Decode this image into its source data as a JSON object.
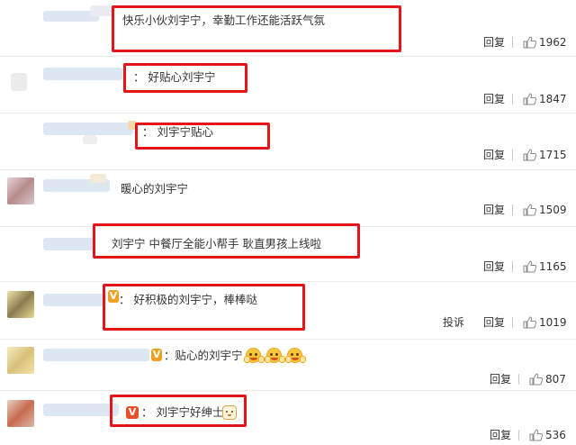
{
  "comments": [
    {
      "text": "快乐小伙刘宇宁，幸勤工作还能活跃气氛",
      "reply": "回复",
      "likes": "1962"
    },
    {
      "text": "：  好贴心刘宇宁",
      "reply": "回复",
      "likes": "1847"
    },
    {
      "text": "：  刘宇宁贴心",
      "reply": "回复",
      "likes": "1715"
    },
    {
      "text": "暖心的刘宇宁",
      "reply": "回复",
      "likes": "1509"
    },
    {
      "text": "刘宇宁 中餐厅全能小帮手 耿直男孩上线啦",
      "reply": "回复",
      "likes": "1165"
    },
    {
      "text": "：  好积极的刘宇宁，棒棒哒",
      "report": "投诉",
      "reply": "回复",
      "likes": "1019"
    },
    {
      "text": "：贴心的刘宇宁",
      "reply": "回复",
      "likes": "807"
    },
    {
      "text": "：  刘宇宁好绅士",
      "reply": "回复",
      "likes": "536"
    }
  ],
  "badges": {
    "vip_mark": "V"
  },
  "colors": {
    "highlight_box": "#e3141a",
    "text": "#333333",
    "separator": "#ececec"
  },
  "icons": {
    "like": "thumbs-up-icon",
    "emoji": "laughing-emoji-icon",
    "cat": "cat-emoji-icon"
  }
}
